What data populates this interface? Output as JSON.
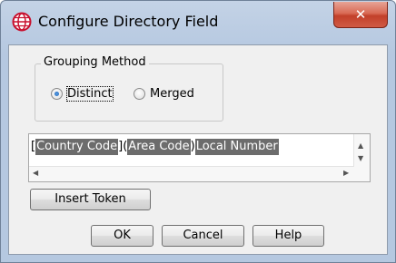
{
  "window": {
    "title": "Configure Directory Field",
    "close_glyph": "✕"
  },
  "grouping": {
    "legend": "Grouping Method",
    "options": [
      {
        "label": "Distinct",
        "selected": true
      },
      {
        "label": "Merged",
        "selected": false
      }
    ]
  },
  "editor": {
    "segments": [
      {
        "text": "[",
        "token": false
      },
      {
        "text": "Country Code",
        "token": true
      },
      {
        "text": "](",
        "token": false
      },
      {
        "text": "Area Code",
        "token": true
      },
      {
        "text": ")",
        "token": false
      },
      {
        "text": "Local Number",
        "token": true
      }
    ]
  },
  "buttons": {
    "insert_token": "Insert Token",
    "ok": "OK",
    "cancel": "Cancel",
    "help": "Help"
  },
  "icons": {
    "app": "globe-icon",
    "close": "close-icon"
  },
  "colors": {
    "titlebar": "#bccde3",
    "close_button": "#d05a44",
    "token_highlight": "#6c6c6c"
  }
}
